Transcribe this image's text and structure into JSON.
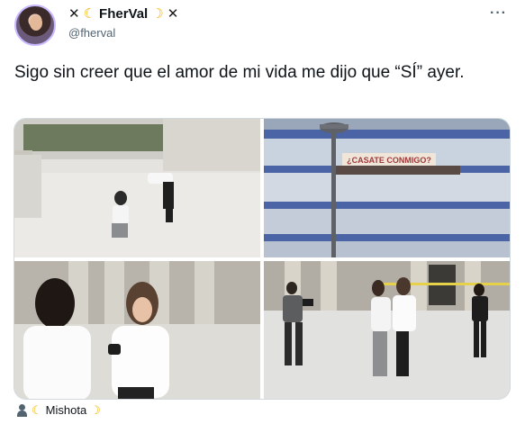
{
  "author": {
    "display_name": "FherVal",
    "handle": "@fherval",
    "name_prefix_icons": [
      "x-mark-icon",
      "crescent-moon-icon"
    ],
    "name_suffix_icons": [
      "crescent-moon-icon",
      "x-mark-icon"
    ]
  },
  "menu": {
    "more_label": "···"
  },
  "tweet": {
    "text": "Sigo sin creer que el amor de mi vida me dijo que “SÍ” ayer."
  },
  "media": {
    "banner_text": "¿CASATE CONMIGO?"
  },
  "footer": {
    "tagged_user": "Mishota"
  },
  "colors": {
    "handle_gray": "#536471",
    "moon_yellow": "#f4b400",
    "border": "#cfd9de"
  }
}
